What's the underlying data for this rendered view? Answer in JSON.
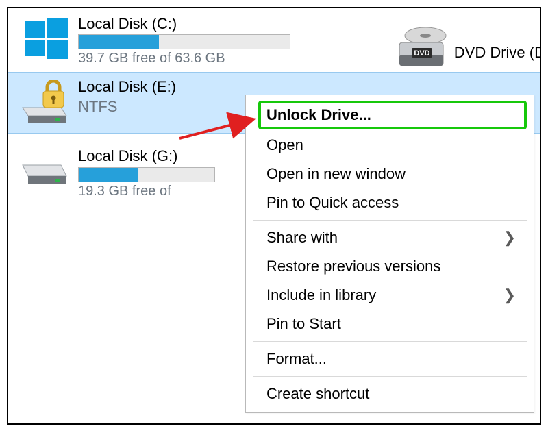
{
  "drives": {
    "c": {
      "title": "Local Disk (C:)",
      "free_text": "39.7 GB free of 63.6 GB",
      "fill_percent": 38
    },
    "e": {
      "title": "Local Disk (E:)",
      "subtitle": "NTFS"
    },
    "g": {
      "title": "Local Disk (G:)",
      "free_text": "19.3 GB free of",
      "fill_percent": 44
    },
    "dvd": {
      "title": "DVD Drive (D"
    }
  },
  "context_menu": {
    "unlock": "Unlock Drive...",
    "open": "Open",
    "open_new": "Open in new window",
    "pin_quick": "Pin to Quick access",
    "share_with": "Share with",
    "restore": "Restore previous versions",
    "include_lib": "Include in library",
    "pin_start": "Pin to Start",
    "format": "Format...",
    "create_shortcut": "Create shortcut"
  }
}
